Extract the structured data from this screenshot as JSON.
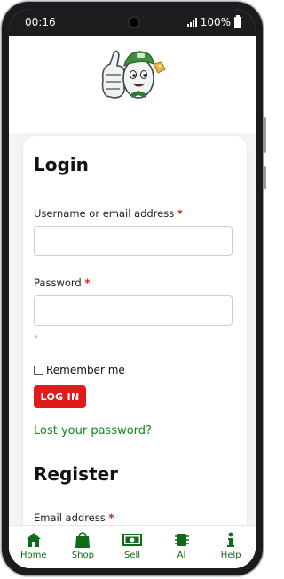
{
  "status": {
    "time": "00:16",
    "battery": "100%"
  },
  "login": {
    "title": "Login",
    "username_label": "Username or email address",
    "password_label": "Password",
    "required_mark": "*",
    "hint": "°",
    "remember_label": "Remember me",
    "login_button": "LOG IN",
    "lost_password": "Lost your password?"
  },
  "register": {
    "title": "Register",
    "email_label": "Email address",
    "required_mark": "*"
  },
  "nav": {
    "items": [
      {
        "label": "Home",
        "icon": "home-icon"
      },
      {
        "label": "Shop",
        "icon": "shopping-bag-icon"
      },
      {
        "label": "Sell",
        "icon": "money-icon"
      },
      {
        "label": "AI",
        "icon": "chip-icon"
      },
      {
        "label": "Help",
        "icon": "info-icon"
      }
    ]
  },
  "colors": {
    "accent_green": "#0f6b17",
    "link_green": "#148a1a",
    "button_red": "#e01b1b",
    "required_red": "#d81b1b"
  }
}
